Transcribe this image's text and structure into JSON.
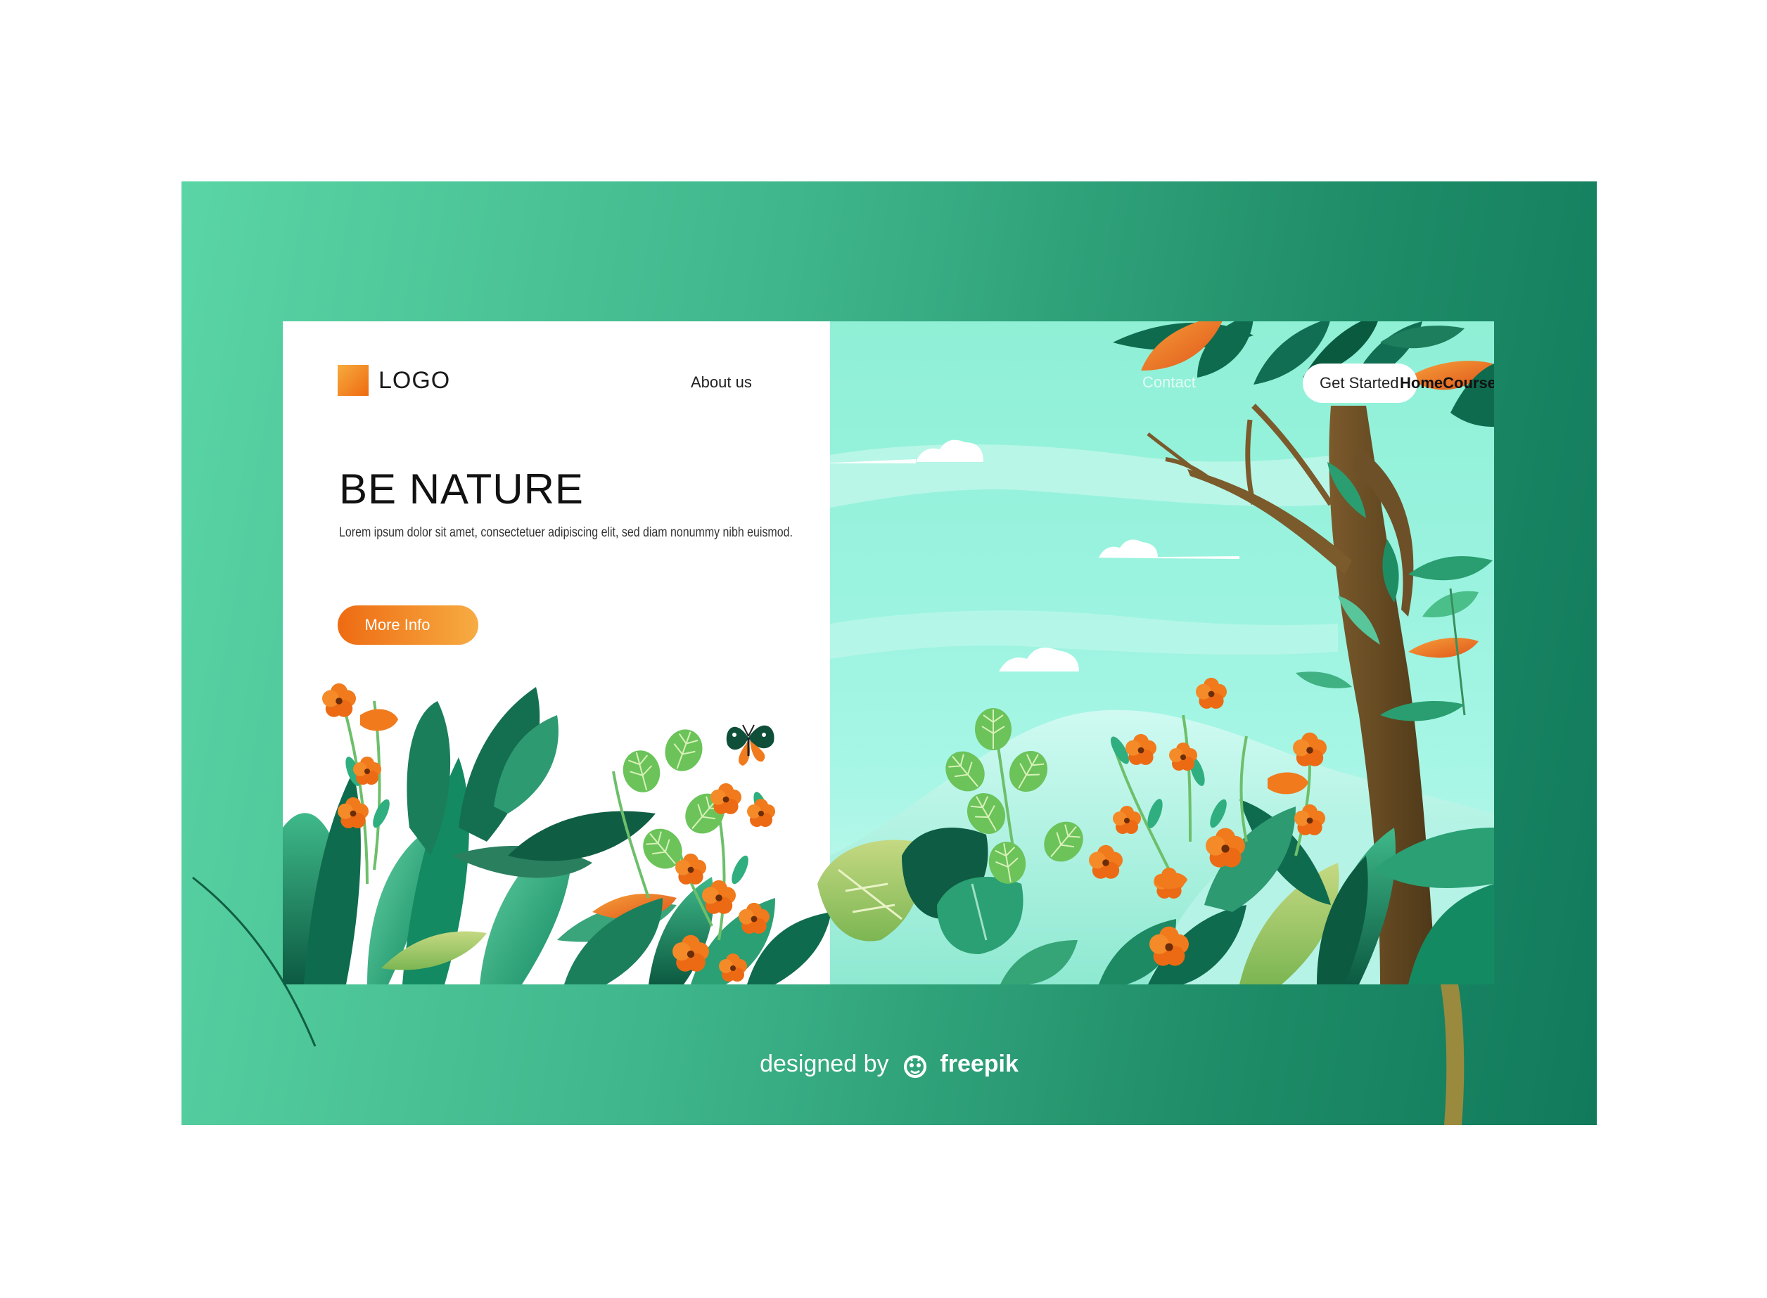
{
  "header": {
    "logo_text": "LOGO",
    "nav_about": "About us",
    "nav_contact": "Contact",
    "get_started": "Get Started",
    "nav_links": "HomeCoursePricing"
  },
  "hero": {
    "title": "BE NATURE",
    "subtitle": "Lorem ipsum dolor sit amet, consectetuer adipiscing elit, sed diam nonummy nibh euismod.",
    "cta_label": "More Info"
  },
  "credit": {
    "prefix": "designed by",
    "brand": "freepik"
  },
  "colors": {
    "frame_start": "#5ad5a5",
    "frame_end": "#117a5b",
    "accent_orange": "#ee6b12",
    "sky": "#9af3df",
    "leaf_dark": "#0f6b4e",
    "trunk": "#5a4022"
  },
  "icons": [
    "logo-square-icon",
    "butterfly-icon",
    "freepik-logo-icon"
  ]
}
